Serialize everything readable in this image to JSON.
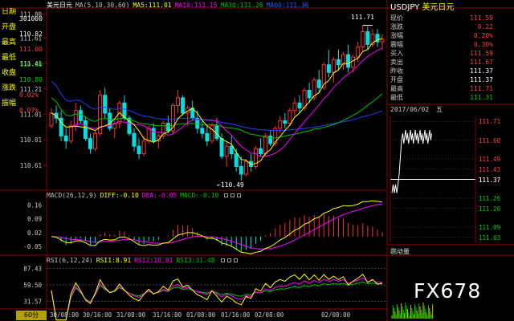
{
  "header": {
    "main": {
      "name": "美元日元",
      "ma_parts": [
        {
          "text": "MA(5,10,30,60)",
          "color": "#c0c0c0"
        },
        {
          "text": "MA5:111.01",
          "color": "#ffff00"
        },
        {
          "text": "MA10:111.15",
          "color": "#ff00ff"
        },
        {
          "text": "MA30:111.26",
          "color": "#00c000"
        },
        {
          "text": "MA60:111.36",
          "color": "#2060ff"
        }
      ]
    },
    "macd": [
      {
        "text": "MACD(26,12,9)",
        "color": "#c0c0c0"
      },
      {
        "text": "DIFF:-0.10",
        "color": "#ffff00"
      },
      {
        "text": "DEA:-0.05",
        "color": "#ff00ff"
      },
      {
        "text": "MACD:-0.10",
        "color": "#00c000"
      }
    ],
    "rsi": [
      {
        "text": "RSI(6,12,24)",
        "color": "#c0c0c0"
      },
      {
        "text": "RSI1:8.91",
        "color": "#ffff00"
      },
      {
        "text": "RSI2:18.81",
        "color": "#ff00ff"
      },
      {
        "text": "RSI3:31.48",
        "color": "#00c000"
      }
    ]
  },
  "left_panel": {
    "items": [
      {
        "label": "日期",
        "value": "301000",
        "value_color": "#ffffff"
      },
      {
        "label": "开盘",
        "value": "110.82",
        "value_color": "#ffffff"
      },
      {
        "label": "最高",
        "value": "111.00",
        "value_color": "#ff4040"
      },
      {
        "label": "最低",
        "value": "110.80",
        "value_color": "#00d000"
      },
      {
        "label": "收盘",
        "value": "110.80",
        "value_color": "#00d000"
      },
      {
        "label": "涨跌",
        "value": "0.02%",
        "value_color": "#ff4040"
      },
      {
        "label": "振幅",
        "value": "0.07%",
        "value_color": "#ff4040"
      }
    ]
  },
  "price_axis": {
    "labels": [
      "111.80",
      "111.61",
      "111.41",
      "111.21",
      "111.01",
      "110.81",
      "110.61"
    ]
  },
  "macd_axis": {
    "labels": [
      "0.16",
      "0.09",
      "0.02",
      "-0.05"
    ]
  },
  "rsi_axis": {
    "labels": [
      "87.43",
      "59.50",
      "31.57"
    ]
  },
  "annotations": {
    "high": "111.71",
    "low": "110.49"
  },
  "time_axis": {
    "period": "60分",
    "labels": [
      "30/08:00",
      "30/16:00",
      "31/08:00",
      "31/16:00",
      "01/08:00",
      "01/16:00",
      "02/08:00",
      "02/08:00"
    ]
  },
  "quote": {
    "symbol": "USDJPY",
    "name": "美元日元",
    "rows": [
      {
        "label": "现价",
        "value": "111.59",
        "color": "#ff4040"
      },
      {
        "label": "涨跌",
        "value": "0.22",
        "color": "#ff4040"
      },
      {
        "label": "涨幅",
        "value": "0.20%",
        "color": "#ff4040"
      },
      {
        "label": "震幅",
        "value": "0.30%",
        "color": "#ff4040"
      },
      {
        "label": "买入",
        "value": "111.59",
        "color": "#ff4040"
      },
      {
        "label": "卖出",
        "value": "111.67",
        "color": "#ff4040"
      },
      {
        "label": "昨收",
        "value": "111.37",
        "color": "#ffffff"
      },
      {
        "label": "开盘",
        "value": "111.37",
        "color": "#ffffff"
      },
      {
        "label": "最高",
        "value": "111.71",
        "color": "#ff4040"
      },
      {
        "label": "最低",
        "value": "111.31",
        "color": "#00d000"
      }
    ]
  },
  "mini": {
    "date": "2017/06/02",
    "weekday": "五",
    "axis": [
      "111.71",
      "111.60",
      "111.49",
      "111.43",
      "111.37",
      "111.26",
      "111.20",
      "111.09",
      "111.03"
    ],
    "prev_close_label": "111.37",
    "volume_label": "跳动量"
  },
  "watermark": "FX678",
  "colors": {
    "up": "#ff3030",
    "down": "#00e0e0",
    "grid": "#8a0000",
    "ma5": "#ffff00",
    "ma10": "#ff00ff",
    "ma30": "#00c000",
    "ma60": "#2040ff"
  },
  "chart_data": {
    "type": "candlestick",
    "period": "60分",
    "ylim": [
      110.42,
      111.84
    ],
    "note": "approximate hourly USDJPY OHLC, values read off axis",
    "candles": [
      [
        110.92,
        111.06,
        110.9,
        111.02
      ],
      [
        111.02,
        111.08,
        110.94,
        110.98
      ],
      [
        110.98,
        111.04,
        110.8,
        110.84
      ],
      [
        110.84,
        110.9,
        110.74,
        110.8
      ],
      [
        110.8,
        110.96,
        110.78,
        110.92
      ],
      [
        110.92,
        111.1,
        110.88,
        111.04
      ],
      [
        111.04,
        111.08,
        110.94,
        110.96
      ],
      [
        110.96,
        110.99,
        110.8,
        110.82
      ],
      [
        110.82,
        110.86,
        110.7,
        110.74
      ],
      [
        110.74,
        110.88,
        110.72,
        110.86
      ],
      [
        110.86,
        111.2,
        110.84,
        111.16
      ],
      [
        111.16,
        111.22,
        110.98,
        111.02
      ],
      [
        111.02,
        111.06,
        110.88,
        110.9
      ],
      [
        110.9,
        110.96,
        110.82,
        110.94
      ],
      [
        110.94,
        111.12,
        110.9,
        111.1
      ],
      [
        111.1,
        111.16,
        110.96,
        110.98
      ],
      [
        110.98,
        111.0,
        110.84,
        110.86
      ],
      [
        110.86,
        110.9,
        110.72,
        110.76
      ],
      [
        110.76,
        110.82,
        110.66,
        110.7
      ],
      [
        110.7,
        110.84,
        110.68,
        110.8
      ],
      [
        110.8,
        110.92,
        110.78,
        110.9
      ],
      [
        110.9,
        110.94,
        110.78,
        110.8
      ],
      [
        110.8,
        110.86,
        110.74,
        110.84
      ],
      [
        110.84,
        110.96,
        110.82,
        110.94
      ],
      [
        110.94,
        111.0,
        110.86,
        110.88
      ],
      [
        110.88,
        111.1,
        110.86,
        111.08
      ],
      [
        111.08,
        111.2,
        111.02,
        111.14
      ],
      [
        111.14,
        111.16,
        111.0,
        111.02
      ],
      [
        111.02,
        111.08,
        110.92,
        111.06
      ],
      [
        111.06,
        111.12,
        110.96,
        110.98
      ],
      [
        110.98,
        111.04,
        110.86,
        110.9
      ],
      [
        110.9,
        110.96,
        110.82,
        110.86
      ],
      [
        110.86,
        110.92,
        110.76,
        110.8
      ],
      [
        110.8,
        110.94,
        110.78,
        110.92
      ],
      [
        110.92,
        110.98,
        110.8,
        110.82
      ],
      [
        110.82,
        110.86,
        110.66,
        110.68
      ],
      [
        110.68,
        110.8,
        110.6,
        110.76
      ],
      [
        110.76,
        110.84,
        110.66,
        110.7
      ],
      [
        110.7,
        110.74,
        110.56,
        110.6
      ],
      [
        110.6,
        110.68,
        110.49,
        110.54
      ],
      [
        110.54,
        110.66,
        110.52,
        110.64
      ],
      [
        110.64,
        110.7,
        110.56,
        110.6
      ],
      [
        110.6,
        110.76,
        110.58,
        110.74
      ],
      [
        110.74,
        110.82,
        110.68,
        110.7
      ],
      [
        110.7,
        110.86,
        110.68,
        110.84
      ],
      [
        110.84,
        110.88,
        110.76,
        110.78
      ],
      [
        110.78,
        110.92,
        110.76,
        110.9
      ],
      [
        110.9,
        111.0,
        110.86,
        110.96
      ],
      [
        110.96,
        111.02,
        110.9,
        110.94
      ],
      [
        110.94,
        111.06,
        110.92,
        111.04
      ],
      [
        111.04,
        111.14,
        111.0,
        111.1
      ],
      [
        111.1,
        111.16,
        111.02,
        111.06
      ],
      [
        111.06,
        111.22,
        111.04,
        111.2
      ],
      [
        111.2,
        111.26,
        111.1,
        111.14
      ],
      [
        111.14,
        111.3,
        111.12,
        111.28
      ],
      [
        111.28,
        111.36,
        111.18,
        111.22
      ],
      [
        111.22,
        111.42,
        111.2,
        111.4
      ],
      [
        111.4,
        111.52,
        111.3,
        111.34
      ],
      [
        111.34,
        111.46,
        111.26,
        111.44
      ],
      [
        111.44,
        111.52,
        111.36,
        111.4
      ],
      [
        111.4,
        111.5,
        111.36,
        111.48
      ],
      [
        111.48,
        111.56,
        111.34,
        111.38
      ],
      [
        111.38,
        111.48,
        111.34,
        111.46
      ],
      [
        111.46,
        111.58,
        111.42,
        111.54
      ],
      [
        111.54,
        111.71,
        111.5,
        111.66
      ],
      [
        111.66,
        111.7,
        111.52,
        111.56
      ],
      [
        111.56,
        111.68,
        111.54,
        111.64
      ],
      [
        111.64,
        111.68,
        111.54,
        111.58
      ],
      [
        111.58,
        111.64,
        111.52,
        111.6
      ]
    ],
    "rsi": {
      "rsi1": 8.91,
      "rsi2": 18.81,
      "rsi3": 31.48
    },
    "macd": {
      "diff": -0.1,
      "dea": -0.05,
      "macd": -0.1
    }
  }
}
